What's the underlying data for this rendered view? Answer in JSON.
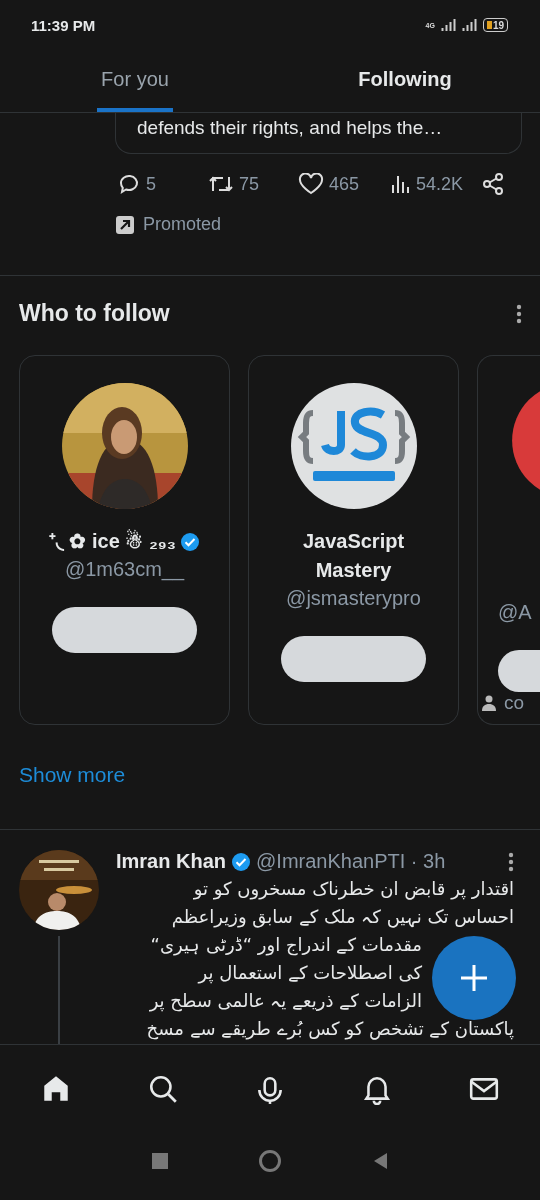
{
  "status_bar": {
    "time": "11:39 PM",
    "network": "4G",
    "battery": "19"
  },
  "tabs": [
    {
      "label": "For you",
      "selected": true
    },
    {
      "label": "Following",
      "selected": false
    }
  ],
  "promoted_tweet": {
    "text_tail": "defends their rights, and helps the…",
    "replies": "5",
    "reposts": "75",
    "likes": "465",
    "views": "54.2K",
    "label": "Promoted"
  },
  "who_to_follow": {
    "title": "Who to follow",
    "cards": [
      {
        "name": "⁺◟ ✿ ice ☃ ₂₉₃",
        "verified": true,
        "handle": "@1m63cm__"
      },
      {
        "name": "JavaScript Mastery",
        "verified": false,
        "handle": "@jsmasterypro"
      },
      {
        "handle": "@A",
        "note": "co"
      }
    ],
    "show_more": "Show more"
  },
  "tweet": {
    "name": "Imran Khan",
    "verified": true,
    "byline": "@ImranKhanPTI · 3h",
    "lines": [
      {
        "kind": "full",
        "text": "اقتدار پر قابض ان خطرناک مسخروں کو تو"
      },
      {
        "kind": "full",
        "text": "احساس تک نہیں کہ ملک کے سابق وزیراعظم"
      },
      {
        "kind": "beside_button",
        "text": "مقدمات کے اندراج اور “ڈرٹی ہیری“"
      },
      {
        "kind": "beside_button",
        "text": "کی اصطلاحات کے استعمال پر"
      },
      {
        "kind": "beside_button",
        "text": "الزامات کے ذریعے یہ عالمی سطح پر"
      },
      {
        "kind": "full",
        "text": "پاکستان کے تشخص کو کس بُرے طریقے سے مسخ"
      }
    ]
  },
  "bottom_nav": [
    {
      "kind": "home",
      "selected": true
    },
    {
      "kind": "search",
      "selected": false
    },
    {
      "kind": "spaces",
      "selected": false
    },
    {
      "kind": "notifications",
      "selected": false
    },
    {
      "kind": "messages",
      "selected": false
    }
  ],
  "system_nav": [
    {
      "kind": "recents"
    },
    {
      "kind": "home"
    },
    {
      "kind": "back"
    }
  ]
}
